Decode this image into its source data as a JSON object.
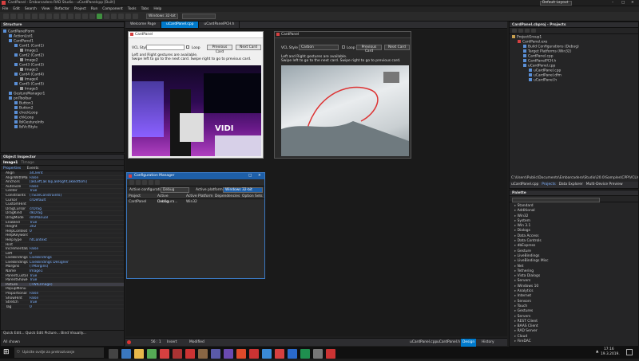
{
  "app": {
    "title": "CardPanel - Embarcadero RAD Studio - uCardPanelcpp [Built]",
    "layout_select": "Default Layout",
    "platform_select": "Windows 32-bit"
  },
  "menu": [
    "File",
    "Edit",
    "Search",
    "View",
    "Refactor",
    "Project",
    "Run",
    "Component",
    "Tools",
    "Tabs",
    "Help"
  ],
  "structure": {
    "title": "Structure",
    "items": [
      {
        "label": "CardPanelForm",
        "depth": 0
      },
      {
        "label": "ActionList1",
        "depth": 1
      },
      {
        "label": "CardPanel1",
        "depth": 1
      },
      {
        "label": "Card1 (Card1)",
        "depth": 2
      },
      {
        "label": "Image1",
        "depth": 3
      },
      {
        "label": "Card2 (Card2)",
        "depth": 2
      },
      {
        "label": "Image2",
        "depth": 3
      },
      {
        "label": "Card3 (Card3)",
        "depth": 2
      },
      {
        "label": "Image3",
        "depth": 3
      },
      {
        "label": "Card4 (Card4)",
        "depth": 2
      },
      {
        "label": "Image4",
        "depth": 3
      },
      {
        "label": "Card5 (Card5)",
        "depth": 2
      },
      {
        "label": "Image5",
        "depth": 3
      },
      {
        "label": "GestureManager1",
        "depth": 1
      },
      {
        "label": "pnlToolbar",
        "depth": 1
      },
      {
        "label": "Button1",
        "depth": 2
      },
      {
        "label": "Button2",
        "depth": 2
      },
      {
        "label": "checkLoop",
        "depth": 2
      },
      {
        "label": "chkLoop",
        "depth": 2
      },
      {
        "label": "lblGestureInfo",
        "depth": 2
      },
      {
        "label": "lblVclStyle",
        "depth": 2
      }
    ]
  },
  "object_inspector": {
    "title": "Object Inspector",
    "selected": "Image1",
    "selected_type": "TImage",
    "tabs": [
      "Properties",
      "Events"
    ],
    "rows": [
      {
        "name": "Align",
        "value": "alClient"
      },
      {
        "name": "AlignWithMargins",
        "value": "False"
      },
      {
        "name": "Anchors",
        "value": "[akLeft,akTop,akRight,akBottom]"
      },
      {
        "name": "AutoSize",
        "value": "False"
      },
      {
        "name": "Center",
        "value": "True"
      },
      {
        "name": "Constraints",
        "value": "(TSizeConstraints)"
      },
      {
        "name": "Cursor",
        "value": "crDefault"
      },
      {
        "name": "CustomHint",
        "value": ""
      },
      {
        "name": "DragCursor",
        "value": "crDrag"
      },
      {
        "name": "DragKind",
        "value": "dkDrag"
      },
      {
        "name": "DragMode",
        "value": "dmManual"
      },
      {
        "name": "Enabled",
        "value": "True"
      },
      {
        "name": "Height",
        "value": "302"
      },
      {
        "name": "HelpContext",
        "value": "0"
      },
      {
        "name": "HelpKeyword",
        "value": ""
      },
      {
        "name": "HelpType",
        "value": "htContext"
      },
      {
        "name": "Hint",
        "value": ""
      },
      {
        "name": "IncrementalDisplay",
        "value": "False"
      },
      {
        "name": "Left",
        "value": "0"
      },
      {
        "name": "LiveBindings",
        "value": "LiveBindings"
      },
      {
        "name": "LiveBindings Designer",
        "value": "LiveBindings Designer"
      },
      {
        "name": "Margins",
        "value": "(TMargins)"
      },
      {
        "name": "Name",
        "value": "Image1"
      },
      {
        "name": "ParentCustomHint",
        "value": "True"
      },
      {
        "name": "ParentShowHint",
        "value": "True"
      },
      {
        "name": "Picture",
        "value": "(TWICImage)"
      },
      {
        "name": "PopupMenu",
        "value": ""
      },
      {
        "name": "Proportional",
        "value": "False"
      },
      {
        "name": "ShowHint",
        "value": "False"
      },
      {
        "name": "Stretch",
        "value": "True"
      },
      {
        "name": "Tag",
        "value": "0"
      }
    ],
    "footer_links": "Quick Edit... Quick Edit Picture... Bind Visually...",
    "footer_status": "All shown"
  },
  "editor_tabs": [
    "Welcome Page",
    "uCardPanel.cpp",
    "uCardPanelPCH.h"
  ],
  "form_designer": {
    "title": "CardPanel",
    "style_label": "VCL Style",
    "style_value": "Carbon",
    "loop_label": "Loop",
    "prev_button": "Previous Card",
    "next_button": "Next Card",
    "info_line1": "Left and Right gestures are available.",
    "info_line2": "Swipe left to go to the next card. Swipe right to go to previous card.",
    "photo_text": "VIDI"
  },
  "running_app": {
    "title": "CardPanel",
    "style_label": "VCL Style",
    "style_value": "Carbon",
    "loop_label": "Loop",
    "prev_button": "Previous Card",
    "next_button": "Next Card",
    "info_line1": "Left and Right gestures are available.",
    "info_line2": "Swipe left to go to the next card. Swipe right to go to previous card."
  },
  "config_manager": {
    "title": "Configuration Manager",
    "active_config_label": "Active configuration:",
    "active_config_value": "Debug",
    "active_platform_label": "Active platform:",
    "active_platform_value": "Windows 32-bit",
    "columns": [
      "Project",
      "Active Configura...",
      "Active Platform",
      "Dependencies",
      "Option Sets"
    ],
    "rows": [
      [
        "CardPanel",
        "Debug",
        "Win32",
        "",
        ""
      ]
    ]
  },
  "status_bar": {
    "position": "56 : 1",
    "mode": "Insert",
    "modified": "Modified",
    "bottom_tabs": [
      "uCardPanel.cpp",
      "uCardPanel.h",
      "Design",
      "History"
    ]
  },
  "projects": {
    "title": "CardPanel.cbproj - Projects",
    "items": [
      {
        "label": "ProjectGroup1",
        "depth": 0
      },
      {
        "label": "CardPanel.exe",
        "depth": 1
      },
      {
        "label": "Build Configurations (Debug)",
        "depth": 2
      },
      {
        "label": "Target Platforms (Win32)",
        "depth": 2
      },
      {
        "label": "CardPanel.cpp",
        "depth": 2
      },
      {
        "label": "CardPanelPCH.h",
        "depth": 2
      },
      {
        "label": "uCardPanel.cpp",
        "depth": 2
      },
      {
        "label": "uCardPanel.cpp",
        "depth": 3
      },
      {
        "label": "uCardPanel.dfm",
        "depth": 3
      },
      {
        "label": "uCardPanel.h",
        "depth": 3
      }
    ],
    "path": "C:\\Users\\Public\\Documents\\Embarcadero\\Studio\\20.0\\Samples\\CPP\\VCL\\CardPanel\\uCardPanel.cpp",
    "tabs": [
      "uCardPanel.cpp",
      "Projects",
      "Data Explorer",
      "Multi-Device Preview"
    ]
  },
  "palette": {
    "title": "Palette",
    "items": [
      "Standard",
      "Additional",
      "Win32",
      "System",
      "Win 3.1",
      "Dialogs",
      "Data Access",
      "Data Controls",
      "dbExpress",
      "Gesture",
      "LiveBindings",
      "LiveBindings Misc",
      "Net",
      "Tethering",
      "Vista Dialogs",
      "Servers",
      "Windows 10",
      "Analytics",
      "Internet",
      "Sensors",
      "Touch",
      "Gestures",
      "Servers",
      "REST Client",
      "BAAS Client",
      "RAD Server",
      "Cloud",
      "FireDAC"
    ]
  },
  "taskbar": {
    "search_placeholder": "Upisite ovdje za pretrazivanje",
    "time": "17:16",
    "date": "19.3.2019."
  }
}
